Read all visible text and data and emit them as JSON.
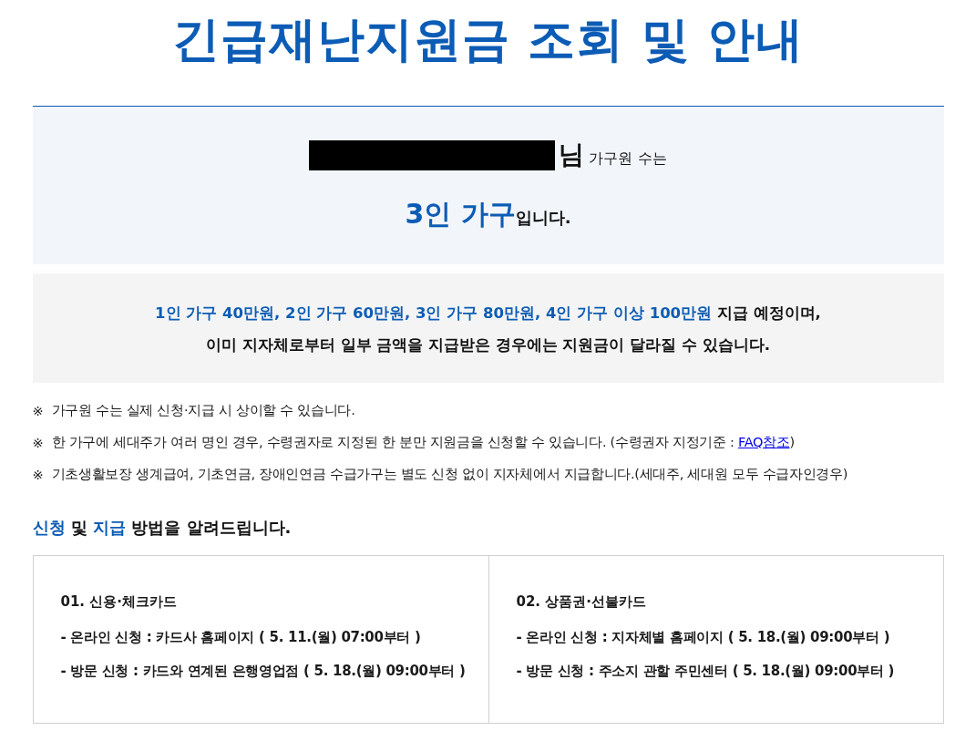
{
  "title": "긴급재난지원금 조회 및 안내",
  "household": {
    "name_redacted": true,
    "suffix": "님",
    "label": "가구원 수는",
    "size": "3인 가구",
    "ending": "입니다."
  },
  "amounts": {
    "lines": [
      [
        {
          "text": "1인 가구 40만원, 2인 가구 60만원, 3인 가구 80만원, 4인 가구 이상 100만원",
          "highlight": true
        },
        {
          "text": " 지급 예정이며,",
          "highlight": false
        }
      ],
      [
        {
          "text": "이미 지자체로부터 일부 금액을 지급받은 경우에는 지원금이 달라질 수 있습니다.",
          "highlight": false
        }
      ]
    ]
  },
  "notes": [
    {
      "mark": "※",
      "text": "가구원 수는 실제 신청·지급 시 상이할 수 있습니다."
    },
    {
      "mark": "※",
      "text": "한 가구에 세대주가 여러 명인 경우, 수령권자로 지정된 한 분만 지원금을 신청할 수 있습니다. (수령권자 지정기준 : ",
      "link": "FAQ참조",
      "after": ")"
    },
    {
      "mark": "※",
      "text": "기초생활보장 생계급여, 기초연금, 장애인연금 수급가구는 별도 신청 없이 지자체에서 지급합니다.(세대주, 세대원 모두 수급자인경우)"
    }
  ],
  "methods_heading": [
    {
      "text": "신청",
      "highlight": true
    },
    {
      "text": " 및 ",
      "highlight": false
    },
    {
      "text": "지급",
      "highlight": true
    },
    {
      "text": " 방법을 알려드립니다.",
      "highlight": false
    }
  ],
  "methods": [
    {
      "title": "01. 신용·체크카드",
      "lines": [
        "- 온라인 신청 : 카드사 홈페이지 ( 5. 11.(월) 07:00부터 )",
        "- 방문 신청 : 카드와 연계된 은행영업점 ( 5. 18.(월) 09:00부터 )"
      ]
    },
    {
      "title": "02. 상품권·선불카드",
      "lines": [
        "- 온라인 신청 : 지자체별 홈페이지 ( 5. 18.(월) 09:00부터 )",
        "- 방문 신청 : 주소지 관할 주민센터 ( 5. 18.(월) 09:00부터 )"
      ]
    }
  ]
}
